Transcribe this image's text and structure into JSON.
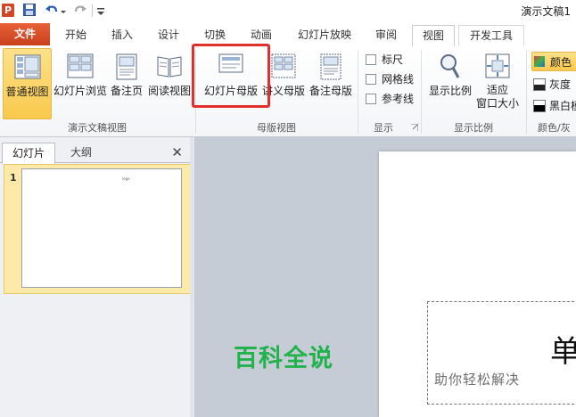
{
  "title_bar": {
    "document_title": "演示文稿1",
    "app_icon_letter": "P"
  },
  "tabs": [
    {
      "label": "文件"
    },
    {
      "label": "开始"
    },
    {
      "label": "插入"
    },
    {
      "label": "设计"
    },
    {
      "label": "切换"
    },
    {
      "label": "动画"
    },
    {
      "label": "幻灯片放映"
    },
    {
      "label": "审阅"
    },
    {
      "label": "视图"
    },
    {
      "label": "开发工具"
    }
  ],
  "active_tab": "视图",
  "ribbon": {
    "presentation_views": {
      "label": "演示文稿视图",
      "buttons": [
        "普通视图",
        "幻灯片浏览",
        "备注页",
        "阅读视图"
      ]
    },
    "master_views": {
      "label": "母版视图",
      "buttons": [
        "幻灯片母版",
        "讲义母版",
        "备注母版"
      ]
    },
    "show": {
      "label": "显示",
      "checkboxes": [
        {
          "label": "标尺",
          "checked": false
        },
        {
          "label": "网格线",
          "checked": false
        },
        {
          "label": "参考线",
          "checked": false
        }
      ]
    },
    "zoom": {
      "label": "显示比例",
      "buttons": [
        "显示比例",
        "适应",
        "窗口大小"
      ]
    },
    "color": {
      "label": "颜色/灰",
      "options": [
        "颜色",
        "灰度",
        "黑白模"
      ]
    }
  },
  "left_panel": {
    "tabs": [
      "幻灯片",
      "大纲"
    ],
    "close_glyph": "✕",
    "thumbnails": [
      {
        "number": "1",
        "text": "logo"
      }
    ]
  },
  "slide": {
    "visible_char": "单"
  },
  "watermark": {
    "main": "百科全说",
    "sub": "助你轻松解决"
  },
  "colors": {
    "file_tab": "#d24726",
    "selection": "#f9c94c",
    "highlight": "#e0302c",
    "watermark": "#22b24c"
  }
}
